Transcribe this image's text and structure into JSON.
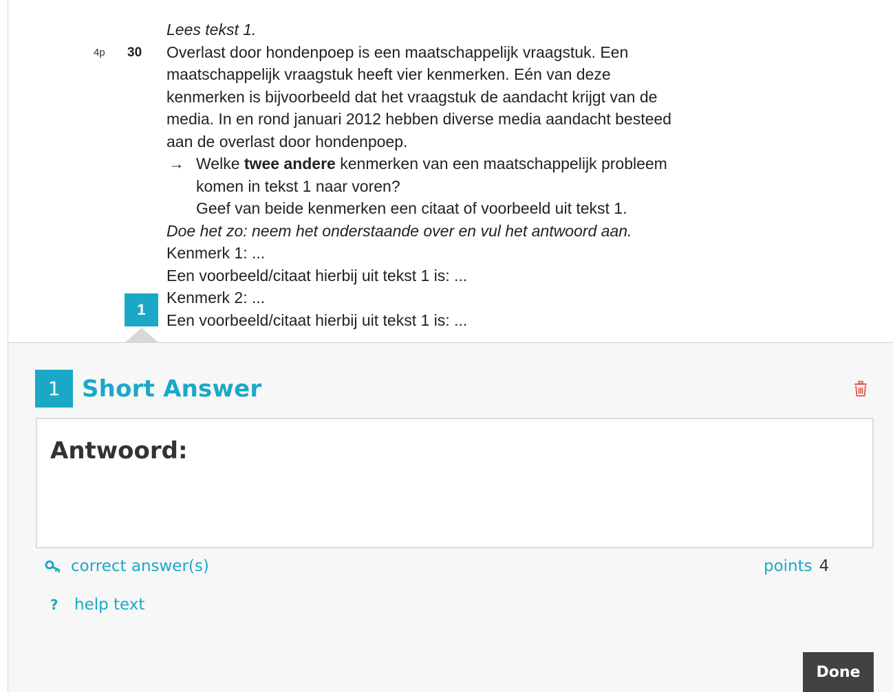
{
  "question": {
    "intro": "Lees tekst 1.",
    "points_label": "4p",
    "number": "30",
    "lines": [
      "Overlast door hondenpoep is een maatschappelijk vraagstuk. Een",
      "maatschappelijk vraagstuk heeft vier kenmerken. Eén van deze",
      "kenmerken is bijvoorbeeld dat het vraagstuk de aandacht krijgt van de",
      "media. In en rond januari 2012 hebben diverse media aandacht besteed",
      "aan de overlast door hondenpoep."
    ],
    "arrow": "→",
    "task_before_bold": "Welke ",
    "task_bold": "twee andere",
    "task_after_bold": " kenmerken van een maatschappelijk probleem",
    "task_line2": "komen in tekst 1 naar voren?",
    "task_line3": "Geef van beide kenmerken een citaat of voorbeeld uit tekst 1.",
    "instruction": "Doe het zo: neem het onderstaande over en vul het antwoord aan.",
    "template_lines": [
      "Kenmerk 1: ...",
      "Een voorbeeld/citaat hierbij uit tekst 1 is: ...",
      "Kenmerk 2: ...",
      "Een voorbeeld/citaat hierbij uit tekst 1 is: ..."
    ],
    "marker_number": "1"
  },
  "panel": {
    "badge_number": "1",
    "title": "Short Answer",
    "answer_label": "Antwoord:",
    "correct_answers_link": "correct answer(s)",
    "help_text_link": "help text",
    "help_icon": "?",
    "points_label": "points",
    "points_value": "4",
    "done_button": "Done",
    "icons": {
      "delete": "trash-icon",
      "correct": "key-icon",
      "help": "question-mark-icon"
    }
  },
  "colors": {
    "accent": "#1ba8c7",
    "delete": "#e0564a",
    "done_bg": "#424242",
    "panel_bg": "#f7f7f7"
  }
}
